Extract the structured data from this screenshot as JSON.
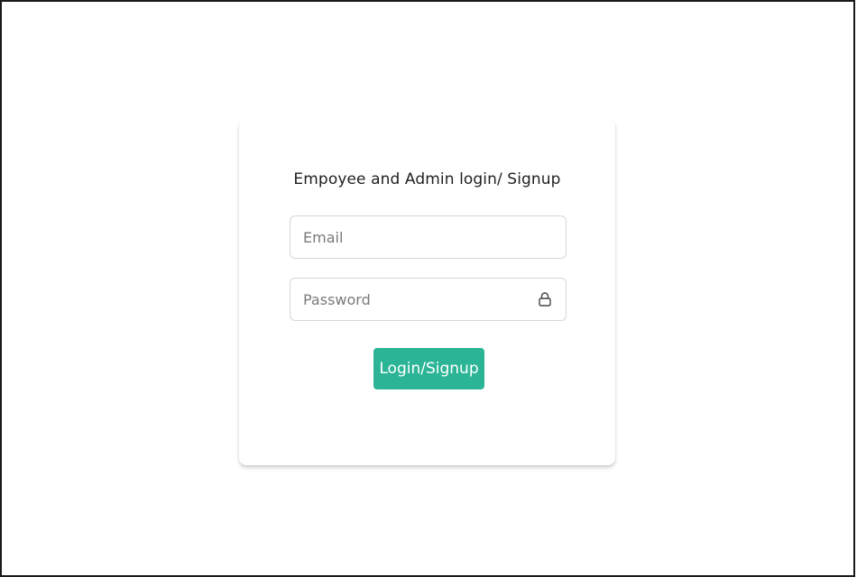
{
  "login_card": {
    "title": "Empoyee and Admin login/ Signup",
    "email": {
      "placeholder": "Email",
      "value": ""
    },
    "password": {
      "placeholder": "Password",
      "value": "",
      "icon": "lock-icon"
    },
    "submit_label": "Login/Signup"
  },
  "colors": {
    "accent": "#2bb596",
    "border": "#d6d6d6",
    "frame": "#1a1a1a"
  }
}
